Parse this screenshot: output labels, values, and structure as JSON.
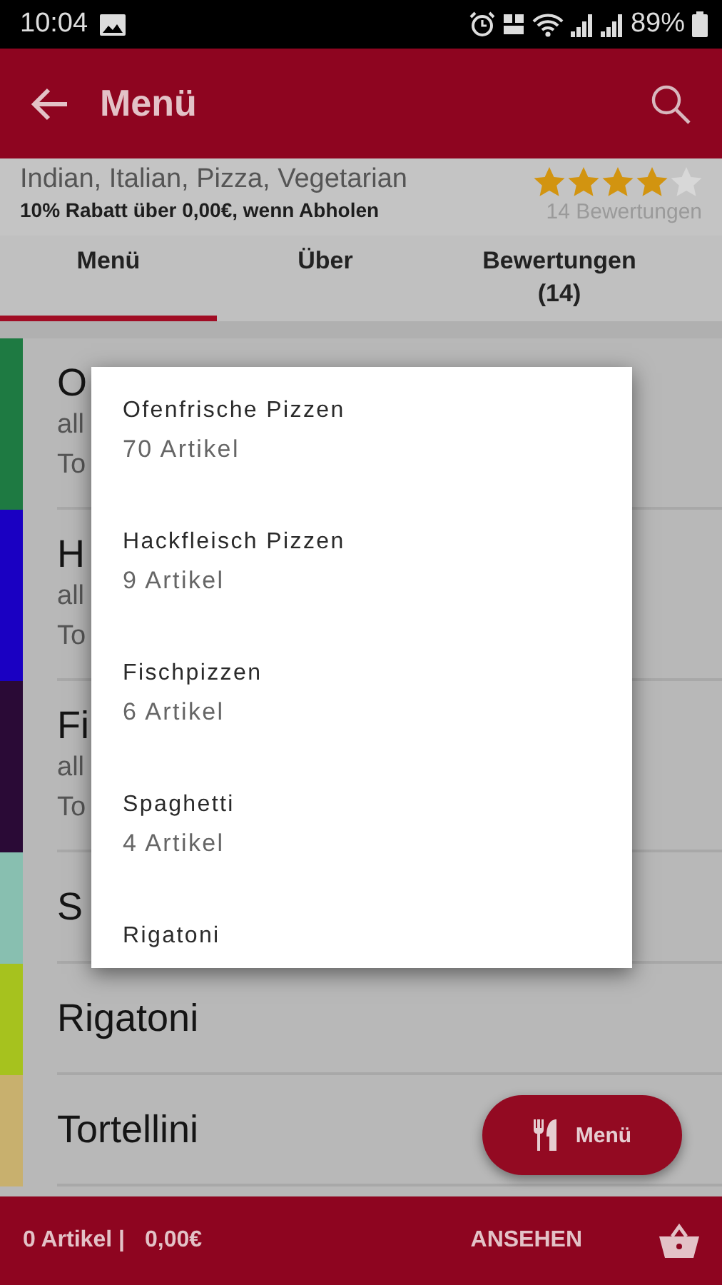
{
  "status_bar": {
    "time": "10:04",
    "battery": "89%"
  },
  "app_bar": {
    "title": "Menü"
  },
  "info": {
    "cuisines": "Indian, Italian, Pizza, Vegetarian",
    "discount": "10% Rabatt über 0,00€, wenn Abholen",
    "rating": {
      "stars": 4,
      "count": "14 Bewertungen"
    }
  },
  "tabs": [
    {
      "label": "Menü",
      "selected": true
    },
    {
      "label": "Über",
      "selected": false
    },
    {
      "label": "Bewertungen\n(14)",
      "selected": false
    }
  ],
  "categories": [
    {
      "title": "O",
      "lines": [
        "all",
        "To"
      ],
      "color": "#1e7a42"
    },
    {
      "title": "H",
      "lines": [
        "all",
        "To"
      ],
      "color": "#1a00c2"
    },
    {
      "title": "Fi",
      "lines": [
        "all",
        "To"
      ],
      "color": "#2a0a36"
    },
    {
      "title": "S",
      "color": "#88bfb0"
    },
    {
      "title": "Rigatoni",
      "color": "#a6c21e"
    },
    {
      "title": "Tortellini",
      "color": "#c8b06e"
    }
  ],
  "popup": {
    "items": [
      {
        "name": "Ofenfrische Pizzen",
        "count": "70 Artikel"
      },
      {
        "name": "Hackfleisch Pizzen",
        "count": "9 Artikel"
      },
      {
        "name": "Fischpizzen",
        "count": "6 Artikel"
      },
      {
        "name": "Spaghetti",
        "count": "4 Artikel"
      },
      {
        "name": "Rigatoni"
      }
    ]
  },
  "fab": {
    "label": "Menü"
  },
  "cart_bar": {
    "items": "0 Artikel |",
    "total": "0,00€",
    "action": "ANSEHEN"
  }
}
